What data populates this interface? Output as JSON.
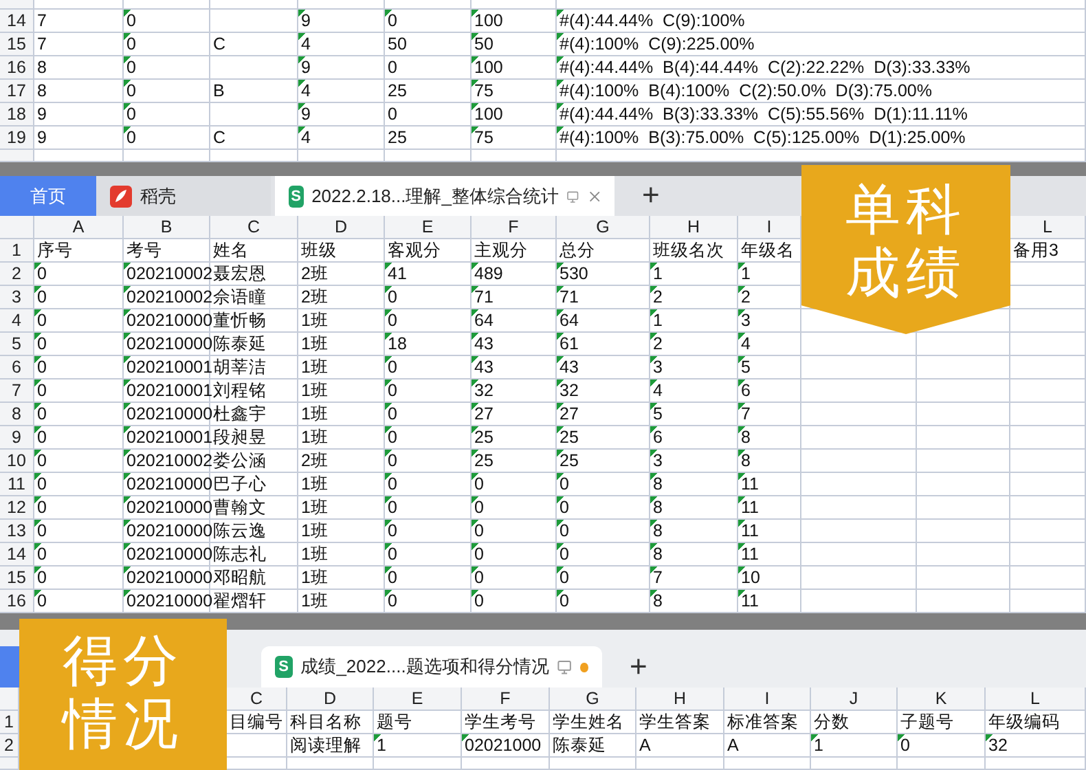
{
  "sheet_top": {
    "rows": [
      {
        "number": "14",
        "flags": [
          false,
          true,
          false,
          true,
          true,
          true,
          true
        ],
        "cells": [
          "7",
          "0",
          null,
          "9",
          "0",
          "100",
          "#(4):44.44%  C(9):100%"
        ]
      },
      {
        "number": "15",
        "flags": [
          false,
          true,
          false,
          true,
          false,
          true,
          true
        ],
        "cells": [
          "7",
          "0",
          "C",
          "4",
          "50",
          "50",
          "#(4):100%  C(9):225.00%"
        ]
      },
      {
        "number": "16",
        "flags": [
          false,
          true,
          false,
          true,
          false,
          true,
          true
        ],
        "cells": [
          "8",
          "0",
          null,
          "9",
          "0",
          "100",
          "#(4):44.44%  B(4):44.44%  C(2):22.22%  D(3):33.33%"
        ]
      },
      {
        "number": "17",
        "flags": [
          false,
          true,
          false,
          true,
          false,
          true,
          true
        ],
        "cells": [
          "8",
          "0",
          "B",
          "4",
          "25",
          "75",
          "#(4):100%  B(4):100%  C(2):50.0%  D(3):75.00%"
        ]
      },
      {
        "number": "18",
        "flags": [
          false,
          true,
          false,
          true,
          false,
          true,
          true
        ],
        "cells": [
          "9",
          "0",
          null,
          "9",
          "0",
          "100",
          "#(4):44.44%  B(3):33.33%  C(5):55.56%  D(1):11.11%"
        ]
      },
      {
        "number": "19",
        "flags": [
          false,
          true,
          false,
          true,
          false,
          true,
          true
        ],
        "cells": [
          "9",
          "0",
          "C",
          "4",
          "25",
          "75",
          "#(4):100%  B(3):75.00%  C(5):125.00%  D(1):25.00%"
        ]
      }
    ]
  },
  "window_main": {
    "tabs": [
      {
        "kind": "home",
        "label": "首页",
        "selected": false
      },
      {
        "kind": "docer",
        "label": "稻壳",
        "selected": false
      },
      {
        "kind": "sheet",
        "icon_text": "S",
        "label": "2022.2.18...理解_整体综合统计",
        "selected": true,
        "closable": true
      }
    ],
    "add_tab": "+",
    "columns": [
      "A",
      "B",
      "C",
      "D",
      "E",
      "F",
      "G",
      "H",
      "I",
      null,
      null,
      "L"
    ],
    "rows": [
      {
        "number": "1",
        "cells": [
          "序号",
          "考号",
          "姓名",
          "班级",
          "客观分",
          "主观分",
          "总分",
          "班级名次",
          "年级名",
          null,
          null,
          "备用3"
        ]
      },
      {
        "number": "2",
        "flags": [
          true,
          true,
          false,
          false,
          true,
          true,
          true,
          true,
          true,
          false,
          false,
          false
        ],
        "cells": [
          "0",
          "020210002",
          "聂宏恩",
          "2班",
          "41",
          "489",
          "530",
          "1",
          "1",
          null,
          null,
          null
        ]
      },
      {
        "number": "3",
        "flags": [
          true,
          true,
          false,
          false,
          true,
          true,
          true,
          true,
          true,
          false,
          false,
          false
        ],
        "cells": [
          "0",
          "020210002",
          "佘语瞳",
          "2班",
          "0",
          "71",
          "71",
          "2",
          "2",
          null,
          null,
          null
        ]
      },
      {
        "number": "4",
        "flags": [
          true,
          true,
          false,
          false,
          true,
          true,
          true,
          true,
          true,
          false,
          false,
          false
        ],
        "cells": [
          "0",
          "020210000",
          "董忻畅",
          "1班",
          "0",
          "64",
          "64",
          "1",
          "3",
          null,
          null,
          null
        ]
      },
      {
        "number": "5",
        "flags": [
          true,
          true,
          false,
          false,
          true,
          true,
          true,
          true,
          true,
          false,
          false,
          false
        ],
        "cells": [
          "0",
          "020210000",
          "陈泰延",
          "1班",
          "18",
          "43",
          "61",
          "2",
          "4",
          null,
          null,
          null
        ]
      },
      {
        "number": "6",
        "flags": [
          true,
          true,
          false,
          false,
          true,
          true,
          true,
          true,
          true,
          false,
          false,
          false
        ],
        "cells": [
          "0",
          "020210001",
          "胡莘洁",
          "1班",
          "0",
          "43",
          "43",
          "3",
          "5",
          null,
          null,
          null
        ]
      },
      {
        "number": "7",
        "flags": [
          true,
          true,
          false,
          false,
          true,
          true,
          true,
          true,
          true,
          false,
          false,
          false
        ],
        "cells": [
          "0",
          "020210001",
          "刘程铭",
          "1班",
          "0",
          "32",
          "32",
          "4",
          "6",
          null,
          null,
          null
        ]
      },
      {
        "number": "8",
        "flags": [
          true,
          true,
          false,
          false,
          true,
          true,
          true,
          true,
          true,
          false,
          false,
          false
        ],
        "cells": [
          "0",
          "020210000",
          "杜鑫宇",
          "1班",
          "0",
          "27",
          "27",
          "5",
          "7",
          null,
          null,
          null
        ]
      },
      {
        "number": "9",
        "flags": [
          true,
          true,
          false,
          false,
          true,
          true,
          true,
          true,
          true,
          false,
          false,
          false
        ],
        "cells": [
          "0",
          "020210001",
          "段昶昱",
          "1班",
          "0",
          "25",
          "25",
          "6",
          "8",
          null,
          null,
          null
        ]
      },
      {
        "number": "10",
        "flags": [
          true,
          true,
          false,
          false,
          true,
          true,
          true,
          true,
          true,
          false,
          false,
          false
        ],
        "cells": [
          "0",
          "020210002",
          "娄公涵",
          "2班",
          "0",
          "25",
          "25",
          "3",
          "8",
          null,
          null,
          null
        ]
      },
      {
        "number": "11",
        "flags": [
          true,
          true,
          false,
          false,
          true,
          true,
          true,
          true,
          true,
          false,
          false,
          false
        ],
        "cells": [
          "0",
          "020210000",
          "巴子心",
          "1班",
          "0",
          "0",
          "0",
          "8",
          "11",
          null,
          null,
          null
        ]
      },
      {
        "number": "12",
        "flags": [
          true,
          true,
          false,
          false,
          true,
          true,
          true,
          true,
          true,
          false,
          false,
          false
        ],
        "cells": [
          "0",
          "020210000",
          "曹翰文",
          "1班",
          "0",
          "0",
          "0",
          "8",
          "11",
          null,
          null,
          null
        ]
      },
      {
        "number": "13",
        "flags": [
          true,
          true,
          false,
          false,
          true,
          true,
          true,
          true,
          true,
          false,
          false,
          false
        ],
        "cells": [
          "0",
          "020210000",
          "陈云逸",
          "1班",
          "0",
          "0",
          "0",
          "8",
          "11",
          null,
          null,
          null
        ]
      },
      {
        "number": "14",
        "flags": [
          true,
          true,
          false,
          false,
          true,
          true,
          true,
          true,
          true,
          false,
          false,
          false
        ],
        "cells": [
          "0",
          "020210000",
          "陈志礼",
          "1班",
          "0",
          "0",
          "0",
          "8",
          "11",
          null,
          null,
          null
        ]
      },
      {
        "number": "15",
        "flags": [
          true,
          true,
          false,
          false,
          true,
          true,
          true,
          true,
          true,
          false,
          false,
          false
        ],
        "cells": [
          "0",
          "020210000",
          "邓昭航",
          "1班",
          "0",
          "0",
          "0",
          "7",
          "10",
          null,
          null,
          null
        ]
      },
      {
        "number": "16",
        "flags": [
          true,
          true,
          false,
          false,
          true,
          true,
          true,
          true,
          true,
          false,
          false,
          false
        ],
        "cells": [
          "0",
          "020210000",
          "翟熠轩",
          "1班",
          "0",
          "0",
          "0",
          "8",
          "11",
          null,
          null,
          null
        ]
      }
    ]
  },
  "window_bottom": {
    "tabs": [
      {
        "kind": "home",
        "selected": false
      },
      {
        "kind": "sheet",
        "icon_text": "S",
        "label": "成绩_2022....题选项和得分情况",
        "selected": true,
        "modified": true
      }
    ],
    "add_tab": "+",
    "columns": [
      null,
      null,
      "C",
      "D",
      "E",
      "F",
      "G",
      "H",
      "I",
      "J",
      "K",
      "L"
    ],
    "rows": [
      {
        "number": "1",
        "cells": [
          null,
          null,
          "目编号",
          "科目名称",
          "题号",
          "学生考号",
          "学生姓名",
          "学生答案",
          "标准答案",
          "分数",
          "子题号",
          "年级编码"
        ]
      },
      {
        "number": "2",
        "flags": [
          false,
          false,
          false,
          false,
          true,
          true,
          false,
          false,
          false,
          true,
          true,
          true
        ],
        "cells": [
          null,
          null,
          null,
          "阅读理解",
          "1",
          "02021000",
          "陈泰延",
          "A",
          "A",
          "1",
          "0",
          "32"
        ]
      }
    ]
  },
  "banners": [
    {
      "lines": [
        "单科",
        "成绩"
      ]
    },
    {
      "lines": [
        "得分",
        "情况"
      ]
    }
  ]
}
